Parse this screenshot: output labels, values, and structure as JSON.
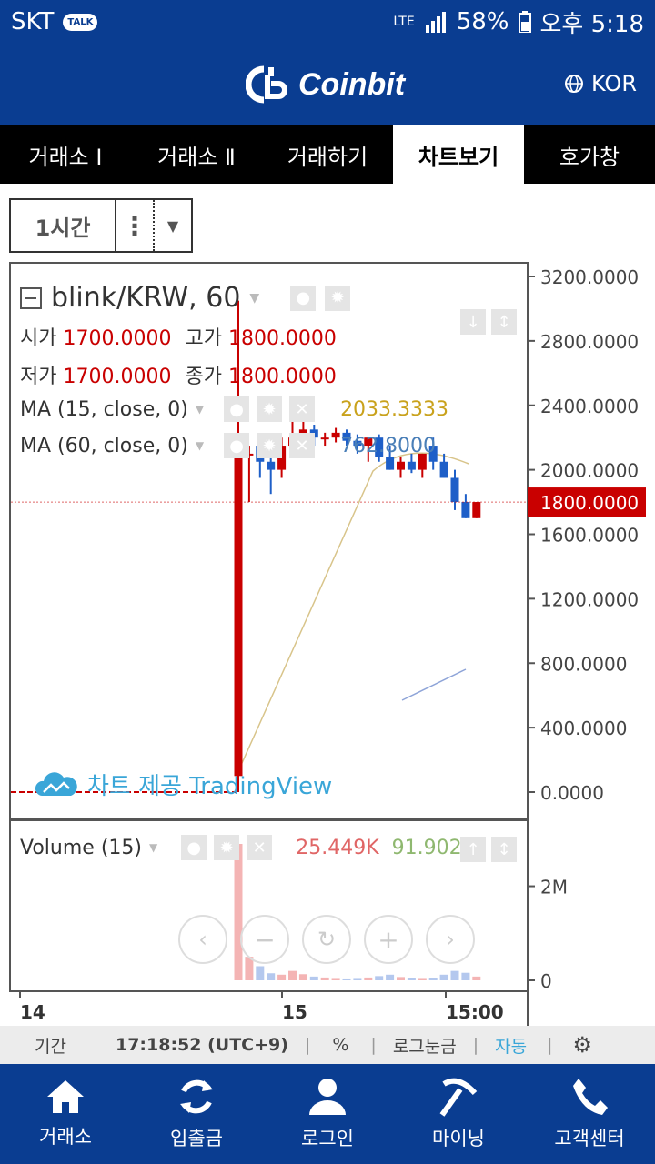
{
  "status_bar": {
    "carrier": "SKT",
    "talk_badge": "TALK",
    "network": "LTE",
    "battery": "58%",
    "time": "오후 5:18"
  },
  "header": {
    "brand": "Coinbit",
    "language": "KOR"
  },
  "tabs": [
    {
      "label": "거래소 Ⅰ",
      "active": false
    },
    {
      "label": "거래소 Ⅱ",
      "active": false
    },
    {
      "label": "거래하기",
      "active": false
    },
    {
      "label": "차트보기",
      "active": true
    },
    {
      "label": "호가창",
      "active": false
    }
  ],
  "interval": {
    "label": "1시간"
  },
  "legend": {
    "symbol": "blink/KRW, 60",
    "open_label": "시가",
    "open_value": "1700.0000",
    "high_label": "고가",
    "high_value": "1800.0000",
    "low_label": "저가",
    "low_value": "1700.0000",
    "close_label": "종가",
    "close_value": "1800.0000",
    "ma15_label": "MA (15, close, 0)",
    "ma15_value": "2033.3333",
    "ma60_label": "MA (60, close, 0)",
    "ma60_value": "762.8000",
    "volume_label": "Volume (15)",
    "volume_value1": "25.449K",
    "volume_value2": "91.902K"
  },
  "watermark": "차트 제공 TradingView",
  "colors": {
    "up": "#c90000",
    "down": "#1e5fc8",
    "ma15": "#d8c48a",
    "ma60": "#8ea4d8",
    "brand": "#0a3d91"
  },
  "chart_data": {
    "type": "candlestick",
    "y_ticks": [
      "3200.0000",
      "2800.0000",
      "2400.0000",
      "2000.0000",
      "1600.0000",
      "1200.0000",
      "800.0000",
      "400.0000",
      "0.0000"
    ],
    "ylim": [
      0,
      3200
    ],
    "price_line_label": "1800.0000",
    "volume_ticks": [
      "2M",
      "0"
    ],
    "x_ticks": [
      "14",
      "15",
      "15:00"
    ],
    "candles": [
      {
        "o": 100,
        "h": 3050,
        "l": 0,
        "c": 2100
      },
      {
        "o": 2100,
        "h": 2150,
        "l": 1800,
        "c": 2100
      },
      {
        "o": 2150,
        "h": 2200,
        "l": 1950,
        "c": 2050
      },
      {
        "o": 2050,
        "h": 2100,
        "l": 1850,
        "c": 2000
      },
      {
        "o": 2000,
        "h": 2200,
        "l": 1950,
        "c": 2150
      },
      {
        "o": 2150,
        "h": 2400,
        "l": 2100,
        "c": 2200
      },
      {
        "o": 2200,
        "h": 2350,
        "l": 2150,
        "c": 2250
      },
      {
        "o": 2250,
        "h": 2280,
        "l": 2150,
        "c": 2200
      },
      {
        "o": 2200,
        "h": 2230,
        "l": 2150,
        "c": 2200
      },
      {
        "o": 2200,
        "h": 2260,
        "l": 2170,
        "c": 2230
      },
      {
        "o": 2230,
        "h": 2250,
        "l": 2150,
        "c": 2180
      },
      {
        "o": 2180,
        "h": 2220,
        "l": 2100,
        "c": 2150
      },
      {
        "o": 2150,
        "h": 2200,
        "l": 2050,
        "c": 2200
      },
      {
        "o": 2200,
        "h": 2220,
        "l": 2050,
        "c": 2080
      },
      {
        "o": 2080,
        "h": 2150,
        "l": 2000,
        "c": 2000
      },
      {
        "o": 2000,
        "h": 2080,
        "l": 1950,
        "c": 2050
      },
      {
        "o": 2050,
        "h": 2100,
        "l": 1980,
        "c": 2000
      },
      {
        "o": 2000,
        "h": 2100,
        "l": 1950,
        "c": 2100
      },
      {
        "o": 2150,
        "h": 2200,
        "l": 2000,
        "c": 2050
      },
      {
        "o": 2050,
        "h": 2100,
        "l": 1950,
        "c": 1950
      },
      {
        "o": 1950,
        "h": 2000,
        "l": 1750,
        "c": 1800
      },
      {
        "o": 1800,
        "h": 1850,
        "l": 1700,
        "c": 1700
      },
      {
        "o": 1700,
        "h": 1800,
        "l": 1700,
        "c": 1800
      }
    ],
    "volume": [
      2900,
      500,
      300,
      150,
      120,
      200,
      130,
      80,
      60,
      30,
      20,
      30,
      60,
      90,
      120,
      70,
      40,
      30,
      50,
      120,
      200,
      160,
      80
    ]
  },
  "toolbar": {
    "period": "기간",
    "clock": "17:18:52 (UTC+9)",
    "percent": "%",
    "log": "로그눈금",
    "auto": "자동"
  },
  "bottom_nav": [
    {
      "label": "거래소",
      "icon": "home-icon"
    },
    {
      "label": "입출금",
      "icon": "refresh-icon"
    },
    {
      "label": "로그인",
      "icon": "user-icon"
    },
    {
      "label": "마이닝",
      "icon": "pickaxe-icon"
    },
    {
      "label": "고객센터",
      "icon": "phone-icon"
    }
  ]
}
